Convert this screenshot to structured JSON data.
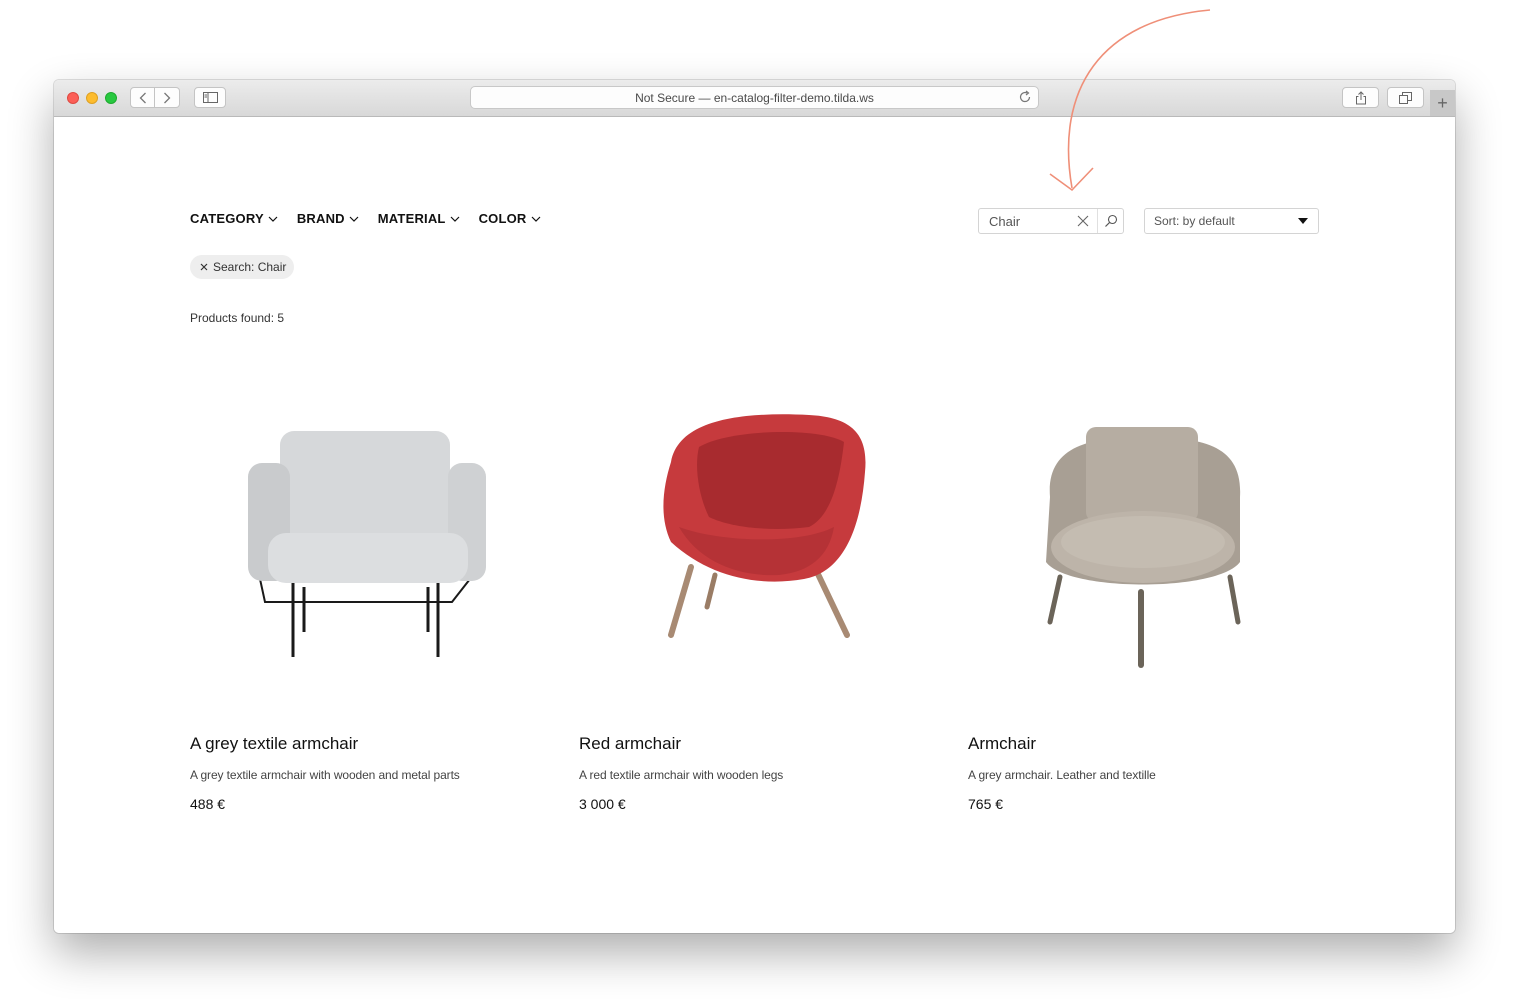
{
  "browser": {
    "url_prefix": "Not Secure —",
    "url_host": "en-catalog-filter-demo.tilda.ws",
    "new_tab_label": "+"
  },
  "filters": [
    {
      "label": "CATEGORY"
    },
    {
      "label": "BRAND"
    },
    {
      "label": "MATERIAL"
    },
    {
      "label": "COLOR"
    }
  ],
  "search": {
    "value": "Chair"
  },
  "sort": {
    "label": "Sort: by default"
  },
  "active_filter": {
    "label": "Search: Chair"
  },
  "results": {
    "text": "Products found: 5"
  },
  "products": [
    {
      "title": "A grey textile armchair",
      "description": "A grey textile armchair with wooden and metal parts",
      "price": "488 €"
    },
    {
      "title": "Red armchair",
      "description": "A red textile armchair with wooden legs",
      "price": "3 000 €"
    },
    {
      "title": "Armchair",
      "description": "A grey armchair. Leather and textille",
      "price": "765 €"
    }
  ],
  "colors": {
    "annotation_arrow": "#ef8f78",
    "chair1": "#d3d5d7",
    "chair2": "#c63a3d",
    "chair3": "#b0a79c"
  }
}
